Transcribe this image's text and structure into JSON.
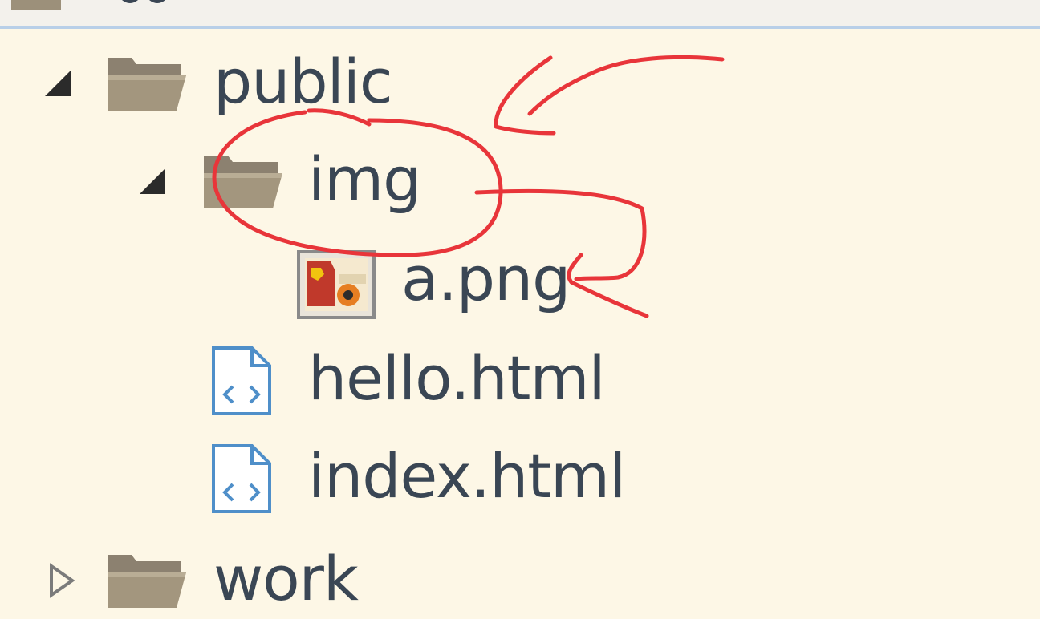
{
  "tree": {
    "items": [
      {
        "label": "public",
        "type": "folder",
        "expanded": true,
        "icon": "folder-open-icon"
      },
      {
        "label": "img",
        "type": "folder",
        "expanded": true,
        "icon": "folder-open-icon"
      },
      {
        "label": "a.png",
        "type": "file",
        "icon": "image-file-icon"
      },
      {
        "label": "hello.html",
        "type": "file",
        "icon": "html-file-icon"
      },
      {
        "label": "index.html",
        "type": "file",
        "icon": "html-file-icon"
      },
      {
        "label": "work",
        "type": "folder",
        "expanded": false,
        "icon": "folder-icon"
      }
    ]
  },
  "colors": {
    "background": "#fdf7e6",
    "label_text": "#3a4654",
    "folder": "#9c907a",
    "html_icon": "#4f8fc9",
    "annotation": "#e8353a"
  }
}
